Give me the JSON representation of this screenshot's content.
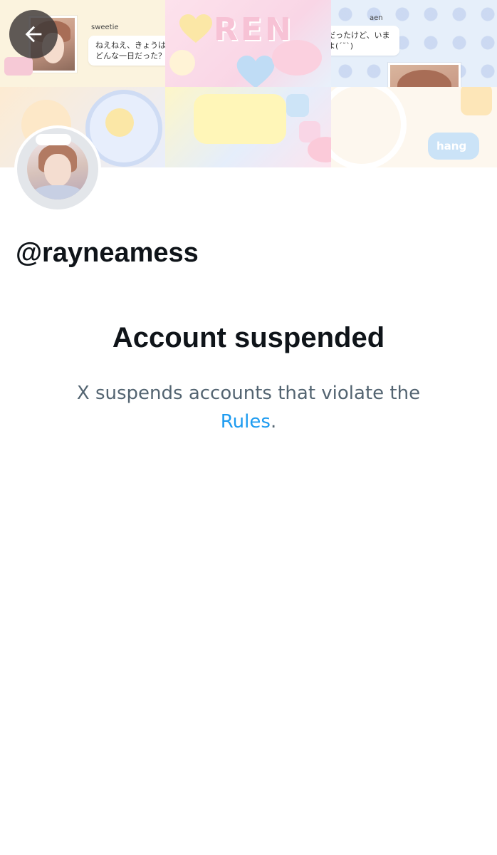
{
  "banner": {
    "bubble_left_name": "sweetie",
    "bubble_left_text_line1": "ねえねえ、きょうは",
    "bubble_left_text_line2": "どんな一日だった？",
    "bubble_right_name": "aen",
    "bubble_right_text_line1": "ふつうだったけど、いま",
    "bubble_right_text_line2": "特別だよ(´˘`)",
    "sign_letters": "REN",
    "sticker_text": "hang",
    "colors": {
      "pink": "#f9d6e6",
      "blue": "#e6effa",
      "cream": "#fbf3de"
    }
  },
  "back_button": {
    "icon": "arrow-left-icon",
    "color": "#ffffff"
  },
  "profile": {
    "handle": "@rayneamess"
  },
  "suspension": {
    "title": "Account suspended",
    "description": "X suspends accounts that violate the",
    "link_text": "Rules",
    "suffix": ".",
    "link_color": "#1d9bf0",
    "text_color": "#536471"
  }
}
